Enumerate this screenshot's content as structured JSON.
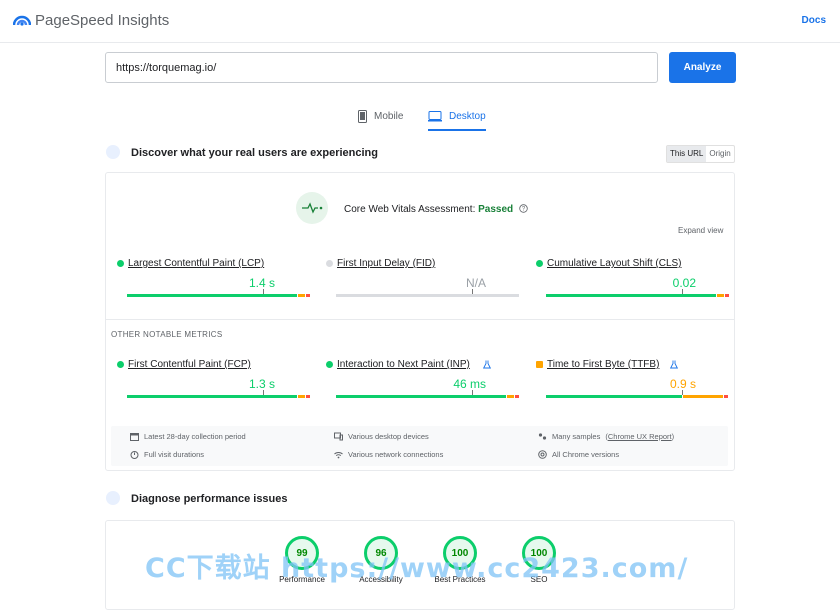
{
  "header": {
    "title": "PageSpeed Insights",
    "docs": "Docs"
  },
  "search": {
    "url": "https://torquemag.io/",
    "analyze": "Analyze"
  },
  "tabs": [
    {
      "label": "Mobile",
      "active": false
    },
    {
      "label": "Desktop",
      "active": true
    }
  ],
  "field": {
    "title": "Discover what your real users are experiencing",
    "toggle": [
      "This URL",
      "Origin"
    ],
    "assessment_prefix": "Core Web Vitals Assessment: ",
    "assessment_status": "Passed",
    "expand": "Expand view",
    "core": [
      {
        "name": "Largest Contentful Paint (LCP)",
        "value": "1.4 s",
        "status": "good",
        "position": 0.74
      },
      {
        "name": "First Input Delay (FID)",
        "value": "N/A",
        "status": "none",
        "position": 0.74
      },
      {
        "name": "Cumulative Layout Shift (CLS)",
        "value": "0.02",
        "status": "good",
        "position": 0.74
      }
    ],
    "other_heading": "OTHER NOTABLE METRICS",
    "other": [
      {
        "name": "First Contentful Paint (FCP)",
        "value": "1.3 s",
        "status": "good",
        "position": 0.74
      },
      {
        "name": "Interaction to Next Paint (INP)",
        "value": "46 ms",
        "status": "good",
        "position": 0.74
      },
      {
        "name": "Time to First Byte (TTFB)",
        "value": "0.9 s",
        "status": "average",
        "position": 0.74
      }
    ],
    "info": [
      "Latest 28-day collection period",
      "Various desktop devices",
      "Many samples",
      "Chrome UX Report",
      "Full visit durations",
      "Various network connections",
      "All Chrome versions"
    ]
  },
  "lab": {
    "title": "Diagnose performance issues",
    "scores": [
      {
        "label": "Performance",
        "score": "99"
      },
      {
        "label": "Accessibility",
        "score": "96"
      },
      {
        "label": "Best Practices",
        "score": "100"
      },
      {
        "label": "SEO",
        "score": "100"
      }
    ]
  },
  "watermark": "CC下载站 https://www.cc2423.com/",
  "colors": {
    "good": "#0cce6b",
    "average": "#ffa400",
    "poor": "#ff4e42",
    "none": "#dadce0",
    "accent": "#1a73e8"
  }
}
